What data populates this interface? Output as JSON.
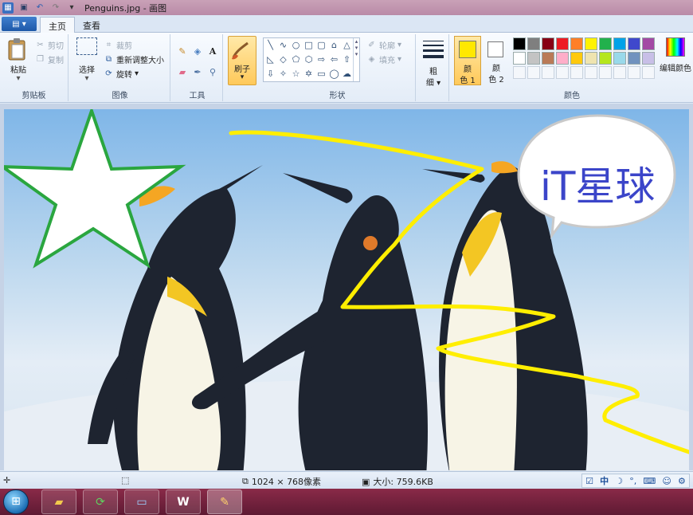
{
  "titlebar": {
    "title": "Penguins.jpg - 画图",
    "quick_access": [
      "save-icon",
      "undo-icon",
      "redo-icon",
      "dropdown-icon"
    ]
  },
  "tabs": [
    {
      "label": "主页",
      "active": true
    },
    {
      "label": "查看",
      "active": false
    }
  ],
  "ribbon": {
    "clipboard": {
      "group_label": "剪贴板",
      "paste_label": "粘贴",
      "cut_label": "剪切",
      "copy_label": "复制"
    },
    "image": {
      "group_label": "图像",
      "select_label": "选择",
      "crop_label": "裁剪",
      "resize_label": "重新调整大小",
      "rotate_label": "旋转"
    },
    "tools": {
      "group_label": "工具",
      "items": [
        "pencil-icon",
        "fill-bucket-icon",
        "text-icon",
        "eraser-icon",
        "color-picker-icon",
        "magnifier-icon"
      ]
    },
    "brushes": {
      "label": "刷子"
    },
    "shapes": {
      "group_label": "形状",
      "outline_label": "轮廓",
      "fill_label": "填充"
    },
    "size": {
      "label_top": "粗",
      "label_bottom": "细"
    },
    "colors": {
      "group_label": "颜色",
      "color1_label_top": "颜",
      "color1_label_bottom": "色 1",
      "color2_label_top": "颜",
      "color2_label_bottom": "色 2",
      "color1_value": "#ffe800",
      "color2_value": "#ffffff",
      "edit_label": "编辑颜色",
      "palette_row1": [
        "#000000",
        "#7f7f7f",
        "#880015",
        "#ed1c24",
        "#ff7f27",
        "#fff200",
        "#22b14c",
        "#00a2e8",
        "#3f48cc",
        "#a349a4"
      ],
      "palette_row2": [
        "#ffffff",
        "#c3c3c3",
        "#b97a57",
        "#ffaec9",
        "#ffc90e",
        "#efe4b0",
        "#b5e61d",
        "#99d9ea",
        "#7092be",
        "#c8bfe7"
      ]
    }
  },
  "canvas": {
    "bubble_text": "iT星球",
    "star_outline_color": "#2aa63f",
    "scribble_color": "#ffee00"
  },
  "statusbar": {
    "dimensions": "1024 × 768像素",
    "size": "大小: 759.6KB",
    "ime_mode": "中"
  },
  "taskbar": {
    "buttons": [
      "explorer-icon",
      "browser-icon",
      "desktop-icon",
      "word-icon",
      "paint-icon"
    ]
  }
}
